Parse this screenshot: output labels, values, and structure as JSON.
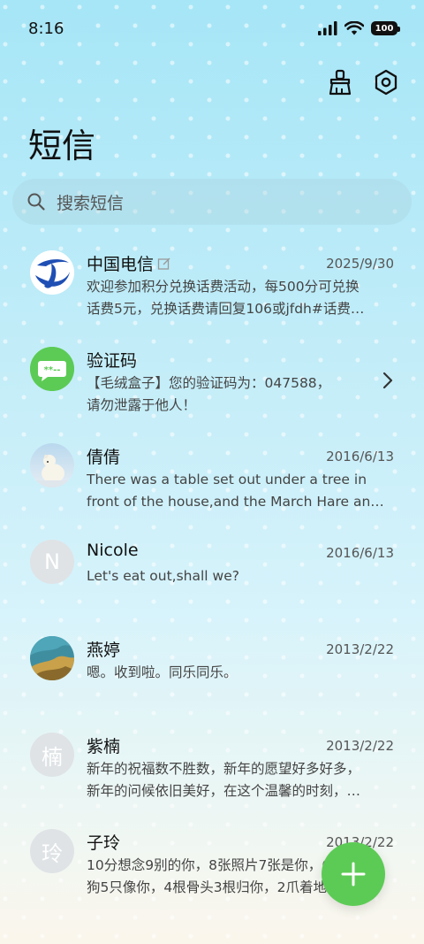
{
  "status": {
    "time": "8:16",
    "battery": "100"
  },
  "header": {
    "title": "短信"
  },
  "search": {
    "placeholder": "搜索短信"
  },
  "conversations": [
    {
      "name": "中国电信",
      "date": "2025/9/30",
      "line1": "欢迎参加积分兑换话费活动，每500分可兑换",
      "line2": "话费5元，兑换话费请回复106或jfdh#话费…"
    },
    {
      "name": "验证码",
      "date": "",
      "line1": "【毛绒盒子】您的验证码为：047588，",
      "line2": "请勿泄露于他人！"
    },
    {
      "name": "倩倩",
      "date": "2016/6/13",
      "line1": "There was a table set out under a tree in",
      "line2": "front of the house,and the March Hare an…"
    },
    {
      "name": "Nicole",
      "avatar_letter": "N",
      "date": "2016/6/13",
      "line1": "Let's eat out,shall we?",
      "line2": ""
    },
    {
      "name": "燕婷",
      "date": "2013/2/22",
      "line1": "嗯。收到啦。同乐同乐。",
      "line2": ""
    },
    {
      "name": "紫楠",
      "avatar_letter": "楠",
      "date": "2013/2/22",
      "line1": "新年的祝福数不胜数，新年的愿望好多好多，",
      "line2": "新年的问候依旧美好，在这个温馨的时刻，…"
    },
    {
      "name": "子玲",
      "avatar_letter": "玲",
      "date": "2013/2/22",
      "line1": "10分想念9别的你，8张照片7张是你，6只小",
      "line2": "狗5只像你，4根骨头3根归你，2爪着地1定…"
    }
  ],
  "colors": {
    "accent": "#5ccb55",
    "telecom_blue": "#1f4fb4"
  }
}
